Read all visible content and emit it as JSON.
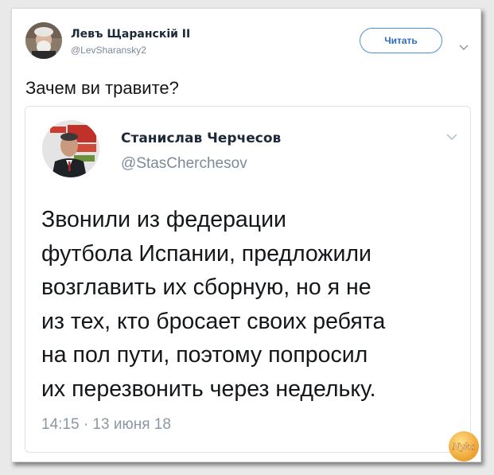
{
  "outer_tweet": {
    "author_name": "Левъ Щаранскiй II",
    "author_handle": "@LevSharansky2",
    "follow_label": "Читать",
    "text": "Зачем ви травите?"
  },
  "quoted_tweet": {
    "author_name": "Станислав Черчесов",
    "author_handle": "@StasCherchesov",
    "body_lines": [
      "Звонили из федерации",
      "футбола Испании, предложили",
      "возглавить их сборную, но я не",
      "из тех, кто бросает своих ребята",
      "на пол пути, поэтому попросил",
      "их перезвонить через недельку."
    ],
    "timestamp": "14:15 · 13 июня 18"
  },
  "watermark": {
    "text": "Nyka"
  },
  "colors": {
    "accent": "#4a90e2",
    "text_primary": "#14171a",
    "text_secondary": "#7d8b98"
  },
  "icons": [
    "chevron-down-icon",
    "avatar-icon"
  ]
}
